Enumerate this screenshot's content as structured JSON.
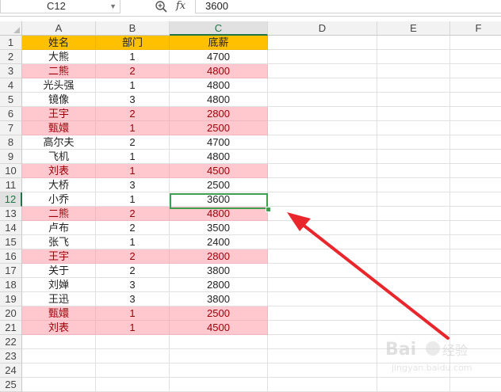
{
  "formula_bar": {
    "cell_ref": "C12",
    "fx_label": "fx",
    "formula_value": "3600"
  },
  "columns": [
    "A",
    "B",
    "C",
    "D",
    "E",
    "F"
  ],
  "active_column": "C",
  "active_row": 12,
  "row_numbers": [
    "1",
    "2",
    "3",
    "4",
    "5",
    "6",
    "7",
    "8",
    "9",
    "10",
    "11",
    "12",
    "13",
    "14",
    "15",
    "16",
    "17",
    "18",
    "19",
    "20",
    "21",
    "22",
    "23",
    "24",
    "25"
  ],
  "table": {
    "headers": [
      "姓名",
      "部门",
      "底薪"
    ],
    "rows": [
      {
        "name": "大熊",
        "dept": "1",
        "salary": "4700",
        "dup": false
      },
      {
        "name": "二熊",
        "dept": "2",
        "salary": "4800",
        "dup": true
      },
      {
        "name": "光头强",
        "dept": "1",
        "salary": "4800",
        "dup": false
      },
      {
        "name": "镜像",
        "dept": "3",
        "salary": "4800",
        "dup": false
      },
      {
        "name": "王宇",
        "dept": "2",
        "salary": "2800",
        "dup": true
      },
      {
        "name": "甄嬛",
        "dept": "1",
        "salary": "2500",
        "dup": true
      },
      {
        "name": "高尔夫",
        "dept": "2",
        "salary": "4700",
        "dup": false
      },
      {
        "name": "飞机",
        "dept": "1",
        "salary": "4800",
        "dup": false
      },
      {
        "name": "刘表",
        "dept": "1",
        "salary": "4500",
        "dup": true
      },
      {
        "name": "大桥",
        "dept": "3",
        "salary": "2500",
        "dup": false
      },
      {
        "name": "小乔",
        "dept": "1",
        "salary": "3600",
        "dup": false
      },
      {
        "name": "二熊",
        "dept": "2",
        "salary": "4800",
        "dup": true
      },
      {
        "name": "卢布",
        "dept": "2",
        "salary": "3500",
        "dup": false
      },
      {
        "name": "张飞",
        "dept": "1",
        "salary": "2400",
        "dup": false
      },
      {
        "name": "王宇",
        "dept": "2",
        "salary": "2800",
        "dup": true
      },
      {
        "name": "关于",
        "dept": "2",
        "salary": "3800",
        "dup": false
      },
      {
        "name": "刘婵",
        "dept": "3",
        "salary": "2800",
        "dup": false
      },
      {
        "name": "王迅",
        "dept": "3",
        "salary": "3800",
        "dup": false
      },
      {
        "name": "甄嬛",
        "dept": "1",
        "salary": "2500",
        "dup": true
      },
      {
        "name": "刘表",
        "dept": "1",
        "salary": "4500",
        "dup": true
      }
    ]
  },
  "colors": {
    "header_fill": "#ffc000",
    "duplicate_fill": "#ffc7ce",
    "duplicate_text": "#9c0006",
    "selection": "#3f9f4f",
    "arrow": "#e8262b"
  }
}
